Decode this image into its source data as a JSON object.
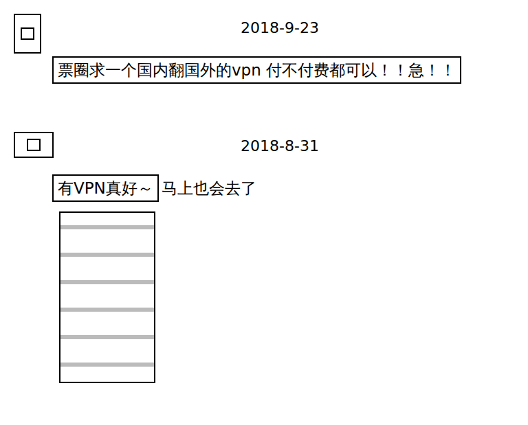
{
  "posts": [
    {
      "date": "2018-9-23",
      "segments": [
        {
          "text": "票圈求一个国内翻国外的vpn 付不付费都可以！！急！！",
          "highlighted": true
        }
      ],
      "has_image": false
    },
    {
      "date": "2018-8-31",
      "segments": [
        {
          "text": "有VPN真好～",
          "highlighted": true
        },
        {
          "text": "马上也会去了",
          "highlighted": false
        }
      ],
      "has_image": true
    }
  ]
}
